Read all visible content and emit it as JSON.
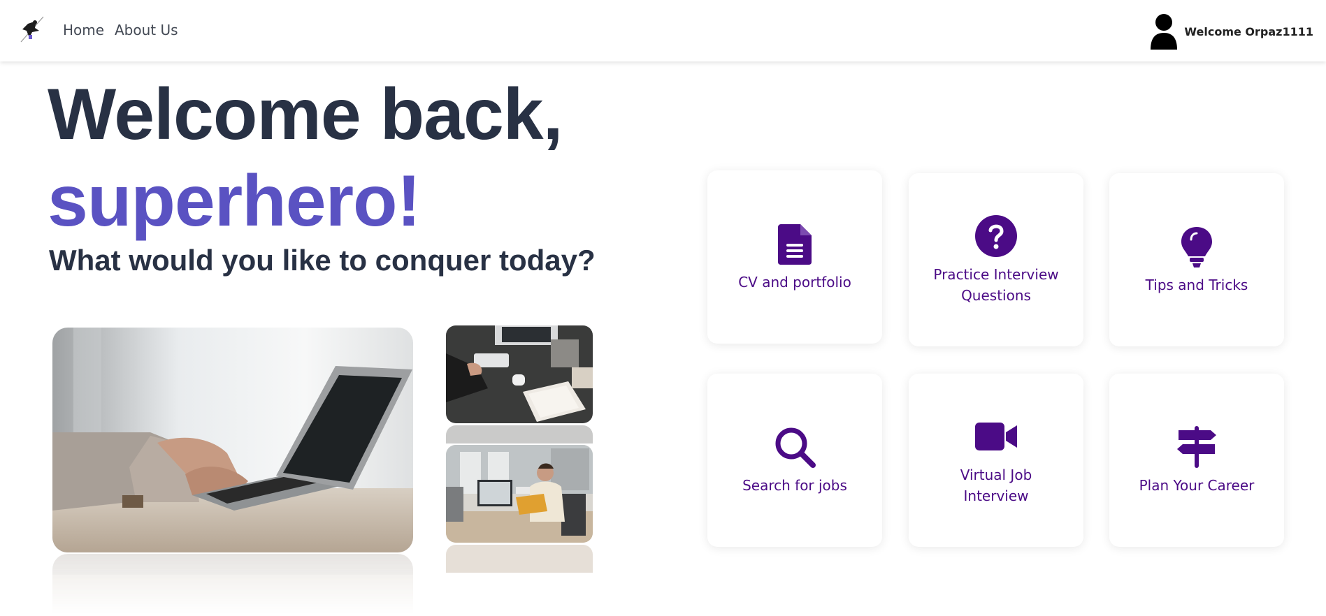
{
  "nav": {
    "home_label": "Home",
    "about_label": "About Us",
    "welcome_label": "Welcome Orpaz1111"
  },
  "hero": {
    "line1": "Welcome back,",
    "line2": "superhero!",
    "subtitle": "What would you like to conquer today?"
  },
  "cards": [
    {
      "label": "CV and portfolio",
      "icon": "file-lines-icon"
    },
    {
      "label": "Practice Interview Questions",
      "icon": "question-circle-icon"
    },
    {
      "label": "Tips and Tricks",
      "icon": "lightbulb-icon"
    },
    {
      "label": "Search for jobs",
      "icon": "magnifying-glass-icon"
    },
    {
      "label": "Virtual Job Interview",
      "icon": "video-camera-icon"
    },
    {
      "label": "Plan Your Career",
      "icon": "signpost-icon"
    }
  ],
  "colors": {
    "heading": "#283144",
    "accent": "#5a52c2",
    "card_text": "#4b0b86"
  }
}
